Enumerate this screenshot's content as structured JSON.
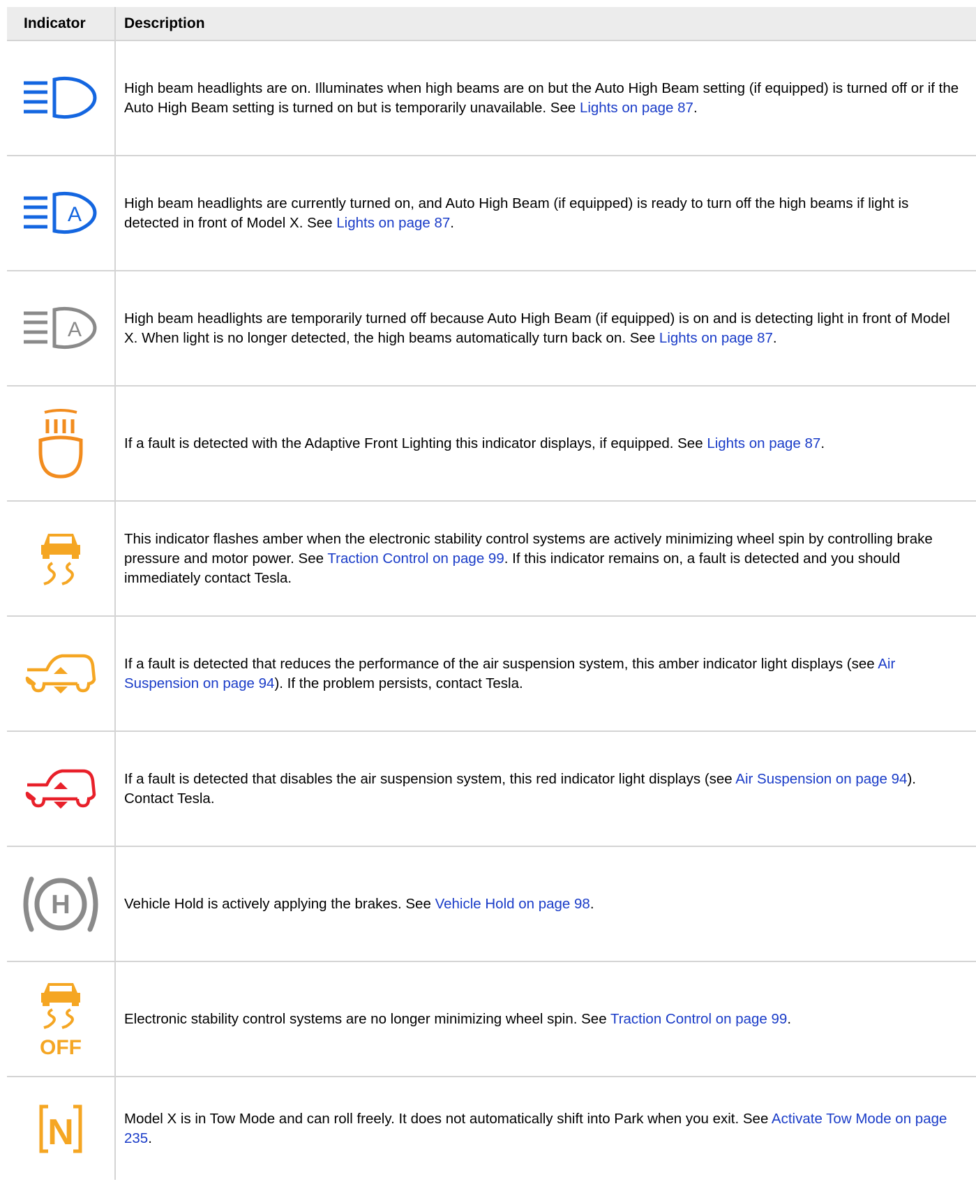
{
  "header": {
    "col1": "Indicator",
    "col2": "Description"
  },
  "colors": {
    "blue": "#1466e0",
    "grey": "#8a8a8a",
    "amber": "#f5a623",
    "orange": "#f28c1e",
    "red": "#e8202a",
    "link": "#1a3cc8"
  },
  "rows": [
    {
      "icon": "high-beam-icon",
      "t1": "High beam headlights are on. Illuminates when high beams are on but the Auto High Beam setting (if equipped) is turned off or if the Auto High Beam setting is turned on but is temporarily unavailable. See ",
      "l1": "Lights on page 87",
      "t2": "."
    },
    {
      "icon": "auto-high-beam-icon",
      "t1": "High beam headlights are currently turned on, and Auto High Beam (if equipped) is ready to turn off the high beams if light is detected in front of Model X. See ",
      "l1": "Lights on page 87",
      "t2": "."
    },
    {
      "icon": "auto-high-beam-off-icon",
      "t1": "High beam headlights are temporarily turned off because Auto High Beam (if equipped) is on and is detecting light in front of Model X. When light is no longer detected, the high beams automatically turn back on. See ",
      "l1": "Lights on page 87",
      "t2": "."
    },
    {
      "icon": "adaptive-lighting-fault-icon",
      "t1": "If a fault is detected with the Adaptive Front Lighting this indicator displays, if equipped. See ",
      "l1": "Lights on page 87",
      "t2": "."
    },
    {
      "icon": "traction-control-icon",
      "t1": "This indicator flashes amber when the electronic stability control systems are actively minimizing wheel spin by controlling brake pressure and motor power. See ",
      "l1": "Traction Control on page 99",
      "t2": ". If this indicator remains on, a fault is detected and you should immediately contact Tesla."
    },
    {
      "icon": "suspension-amber-icon",
      "t1": "If a fault is detected that reduces the performance of the air suspension system, this amber indicator light displays (see ",
      "l1": "Air Suspension on page 94",
      "t2": "). If the problem persists, contact Tesla."
    },
    {
      "icon": "suspension-red-icon",
      "t1": "If a fault is detected that disables the air suspension system, this red indicator light displays (see ",
      "l1": "Air Suspension on page 94",
      "t2": "). Contact Tesla."
    },
    {
      "icon": "vehicle-hold-icon",
      "t1": "Vehicle Hold is actively applying the brakes. See ",
      "l1": "Vehicle Hold on page 98",
      "t2": "."
    },
    {
      "icon": "traction-control-off-icon",
      "t1": "Electronic stability control systems are no longer minimizing wheel spin. See ",
      "l1": "Traction Control on page 99",
      "t2": "."
    },
    {
      "icon": "tow-mode-icon",
      "t1": "Model X is in Tow Mode and can roll freely. It does not automatically shift into Park when you exit. See ",
      "l1": "Activate Tow Mode on page 235",
      "t2": "."
    }
  ],
  "icon_text": {
    "hold_letter": "H",
    "auto_letter": "A",
    "off_label": "OFF",
    "tow_letter": "N"
  }
}
